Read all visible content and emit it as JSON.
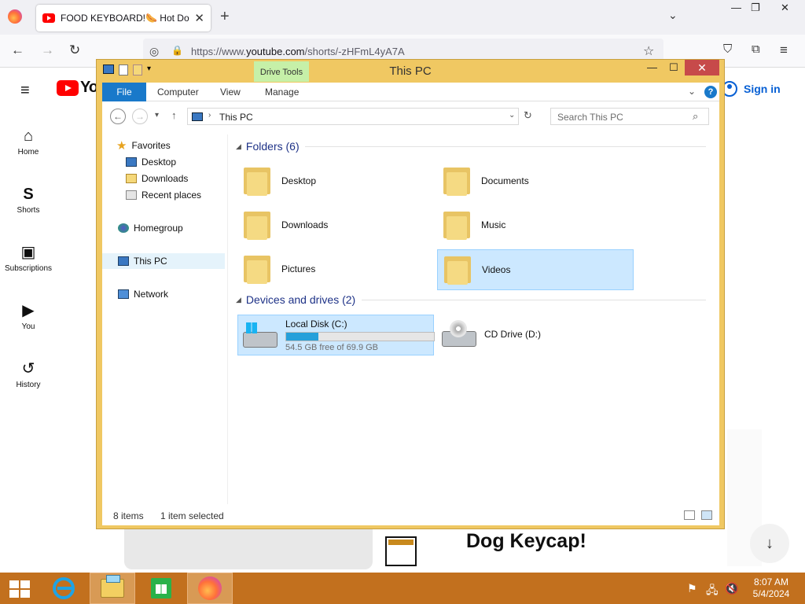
{
  "browser": {
    "tab_title": "FOOD KEYBOARD!🌭 Hot Dog Keycap!",
    "tab_close": "✕",
    "new_tab": "+",
    "list_all_tabs": "⌄",
    "minimize": "—",
    "restore": "❐",
    "close": "✕",
    "url_prefix": "https://www.",
    "url_domain": "youtube.com",
    "url_path": "/shorts/-zHFmL4yA7A",
    "back": "←",
    "forward": "→",
    "reload": "↻",
    "shield": "◎",
    "lock": "🔒",
    "bookmark": "☆",
    "pocket": "⛉",
    "extensions": "⧉",
    "menu": "≡"
  },
  "youtube": {
    "menu_icon": "≡",
    "logo_text": "Yo",
    "sidebar": [
      {
        "label": "Home",
        "icon": "⌂"
      },
      {
        "label": "Shorts",
        "icon": "S"
      },
      {
        "label": "Subscriptions",
        "icon": "▣"
      },
      {
        "label": "You",
        "icon": "▶"
      },
      {
        "label": "History",
        "icon": "↺"
      }
    ],
    "sign_in": "Sign in",
    "video_title_partial": "Dog Keycap!",
    "scroll_down": "↓"
  },
  "explorer": {
    "title": "This PC",
    "contextual_tab": "Drive Tools",
    "ribbon_tabs": [
      "File",
      "Computer",
      "View",
      "Manage"
    ],
    "help": "?",
    "minimize": "—",
    "maximize": "☐",
    "close": "✕",
    "back": "←",
    "forward": "→",
    "recent": "▾",
    "up": "↑",
    "address_sep": "›",
    "address": "This PC",
    "address_dropdown": "⌄",
    "refresh": "↻",
    "search_placeholder": "Search This PC",
    "search_icon": "⌕",
    "nav_pane": {
      "favorites": "Favorites",
      "favorites_items": [
        "Desktop",
        "Downloads",
        "Recent places"
      ],
      "homegroup": "Homegroup",
      "this_pc": "This PC",
      "network": "Network"
    },
    "folders_header": "Folders (6)",
    "folders": [
      "Desktop",
      "Documents",
      "Downloads",
      "Music",
      "Pictures",
      "Videos"
    ],
    "selected_folder": "Videos",
    "devices_header": "Devices and drives (2)",
    "drives": [
      {
        "name": "Local Disk (C:)",
        "free_text": "54.5 GB free of 69.9 GB",
        "used_fraction": 0.22
      },
      {
        "name": "CD Drive (D:)"
      }
    ],
    "status_items": "8 items",
    "status_selected": "1 item selected"
  },
  "taskbar": {
    "clock_time": "8:07 AM",
    "clock_date": "5/4/2024",
    "tray_flag": "⚑",
    "tray_network": "🖧",
    "tray_volume": "🔇"
  },
  "colors": {
    "explorer_frame": "#f0c862",
    "ribbon_file": "#1979ca",
    "drive_tools": "#c6f0a8",
    "selection": "#cce8ff",
    "taskbar": "#c2701e",
    "youtube_red": "#ff0000",
    "sign_in_blue": "#065fd4"
  }
}
